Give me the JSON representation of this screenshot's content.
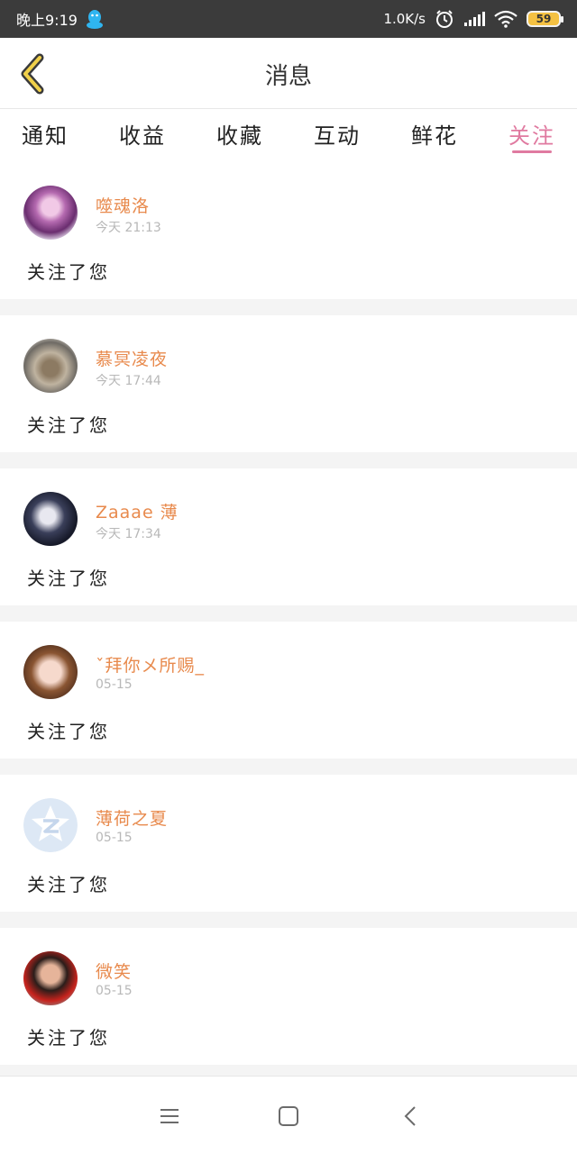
{
  "status_bar": {
    "time": "晚上9:19",
    "net_speed": "1.0K/s",
    "battery": "59",
    "icons": [
      "qq-icon",
      "alarm-icon",
      "signal-icon",
      "wifi-icon",
      "battery-icon"
    ]
  },
  "header": {
    "title": "消息",
    "back_icon": "chevron-left-icon"
  },
  "tabs": [
    {
      "label": "通知",
      "active": false
    },
    {
      "label": "收益",
      "active": false
    },
    {
      "label": "收藏",
      "active": false
    },
    {
      "label": "互动",
      "active": false
    },
    {
      "label": "鲜花",
      "active": false
    },
    {
      "label": "关注",
      "active": true
    }
  ],
  "notifications": [
    {
      "name": "噬魂洛",
      "time": "今天 21:13",
      "action": "关注了您"
    },
    {
      "name": "慕冥凌夜",
      "time": "今天 17:44",
      "action": "关注了您"
    },
    {
      "name": "Zaaae 薄",
      "time": "今天 17:34",
      "action": "关注了您"
    },
    {
      "name": "ˇ拜你メ所赐_",
      "time": "05-15",
      "action": "关注了您"
    },
    {
      "name": "薄荷之夏",
      "time": "05-15",
      "action": "关注了您"
    },
    {
      "name": "微笑",
      "time": "05-15",
      "action": "关注了您"
    }
  ],
  "colors": {
    "accent": "#e07aa0",
    "username": "#e88a4d",
    "status_bar": "#3b3b3b",
    "separator": "#f4f4f4",
    "back_icon": "#f0d04a"
  },
  "nav": [
    "menu-icon",
    "home-icon",
    "back-icon"
  ]
}
